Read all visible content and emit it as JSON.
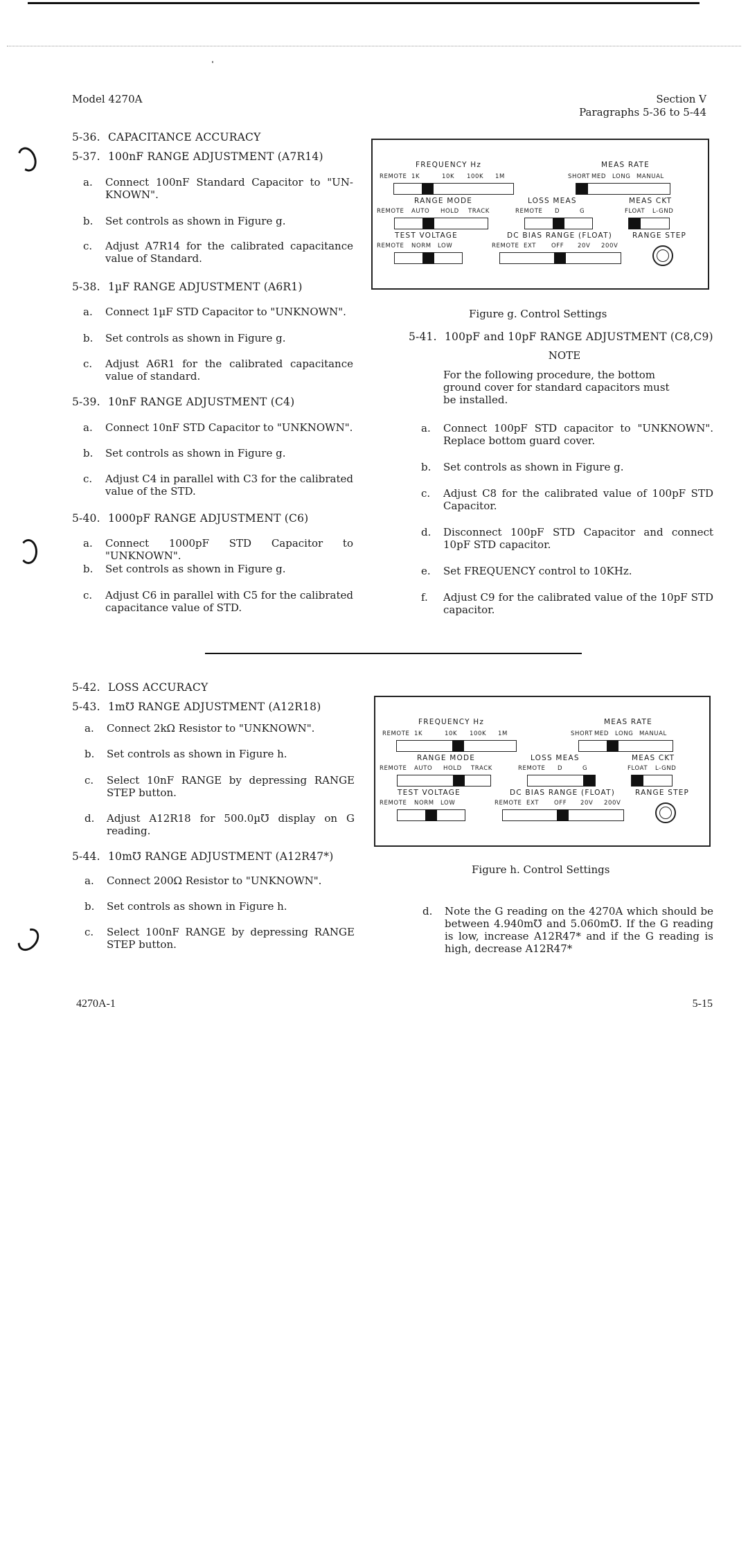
{
  "header": {
    "model": "Model 4270A",
    "section": "Section V",
    "paragraphs": "Paragraphs 5-36 to 5-44"
  },
  "left_column_top": [
    {
      "num": "5-36.",
      "title": "CAPACITANCE ACCURACY",
      "steps": []
    },
    {
      "num": "5-37.",
      "title": "100nF RANGE ADJUSTMENT (A7R14)",
      "steps": [
        {
          "label": "a.",
          "text": "Connect 100nF Standard Capacitor to \"UN-KNOWN\"."
        },
        {
          "label": "b.",
          "text": "Set controls as shown in Figure g."
        },
        {
          "label": "c.",
          "text": "Adjust A7R14 for the calibrated capacitance value of Standard."
        }
      ]
    },
    {
      "num": "5-38.",
      "title": "1µF RANGE ADJUSTMENT (A6R1)",
      "steps": [
        {
          "label": "a.",
          "text": "Connect 1µF STD Capacitor to \"UNKNOWN\"."
        },
        {
          "label": "b.",
          "text": "Set controls as shown in Figure g."
        },
        {
          "label": "c.",
          "text": "Adjust A6R1 for the calibrated capacitance value of standard."
        }
      ]
    },
    {
      "num": "5-39.",
      "title": "10nF RANGE ADJUSTMENT (C4)",
      "steps": [
        {
          "label": "a.",
          "text": "Connect 10nF STD Capacitor to \"UNKNOWN\"."
        },
        {
          "label": "b.",
          "text": "Set controls as shown in Figure g."
        },
        {
          "label": "c.",
          "text": "Adjust C4 in parallel with C3 for the calibrated value of the STD."
        }
      ]
    },
    {
      "num": "5-40.",
      "title": "1000pF RANGE ADJUSTMENT (C6)",
      "steps": [
        {
          "label": "a.",
          "text": "Connect 1000pF STD Capacitor to \"UNKNOWN\"."
        },
        {
          "label": "b.",
          "text": "Set controls as shown in Figure g."
        },
        {
          "label": "c.",
          "text": "Adjust C6 in parallel with C5 for the calibrated capacitance value of STD."
        }
      ]
    }
  ],
  "right_column_top": {
    "figure_caption": "Figure g.   Control Settings",
    "para": {
      "num": "5-41.",
      "title": "100pF and 10pF RANGE ADJUSTMENT (C8,C9)"
    },
    "note_title": "NOTE",
    "note_body": "For the following procedure, the bottom ground cover for standard capacitors must be installed.",
    "steps": [
      {
        "label": "a.",
        "text": "Connect 100pF STD capacitor to \"UNKNOWN\". Replace bottom guard cover."
      },
      {
        "label": "b.",
        "text": "Set controls as shown in Figure g."
      },
      {
        "label": "c.",
        "text": "Adjust C8 for the calibrated value of 100pF STD Capacitor."
      },
      {
        "label": "d.",
        "text": "Disconnect 100pF STD Capacitor and connect 10pF STD capacitor."
      },
      {
        "label": "e.",
        "text": "Set FREQUENCY control to 10KHz."
      },
      {
        "label": "f.",
        "text": "Adjust C9 for the calibrated value of the 10pF STD capacitor."
      }
    ]
  },
  "left_column_bottom": [
    {
      "num": "5-42.",
      "title": "LOSS ACCURACY",
      "steps": []
    },
    {
      "num": "5-43.",
      "title": "1m℧ RANGE ADJUSTMENT (A12R18)",
      "steps": [
        {
          "label": "a.",
          "text": "Connect 2kΩ Resistor to \"UNKNOWN\"."
        },
        {
          "label": "b.",
          "text": "Set controls as shown in Figure h."
        },
        {
          "label": "c.",
          "text": "Select 10nF RANGE by depressing RANGE STEP button."
        },
        {
          "label": "d.",
          "text": "Adjust A12R18 for 500.0µ℧ display on G reading."
        }
      ]
    },
    {
      "num": "5-44.",
      "title": "10m℧ RANGE ADJUSTMENT (A12R47*)",
      "steps": [
        {
          "label": "a.",
          "text": "Connect 200Ω Resistor to \"UNKNOWN\"."
        },
        {
          "label": "b.",
          "text": "Set controls as shown in Figure h."
        },
        {
          "label": "c.",
          "text": "Select 100nF RANGE by depressing RANGE STEP button."
        }
      ]
    }
  ],
  "right_column_bottom": {
    "figure_caption": "Figure h.   Control Settings",
    "steps": [
      {
        "label": "d.",
        "text": "Note the G reading on the 4270A which should be between 4.940m℧ and 5.060m℧. If the G reading is low, increase A12R47* and if the G reading is high, decrease A12R47*"
      }
    ]
  },
  "panel_labels": {
    "frequency": {
      "title": "FREQUENCY Hz",
      "options": [
        "REMOTE",
        "1K",
        "10K",
        "100K",
        "1M"
      ]
    },
    "meas_rate": {
      "title": "MEAS RATE",
      "options": [
        "SHORT",
        "MED",
        "LONG",
        "MANUAL"
      ]
    },
    "range_mode": {
      "title": "RANGE MODE",
      "options": [
        "REMOTE",
        "AUTO",
        "HOLD",
        "TRACK"
      ]
    },
    "loss_meas": {
      "title": "LOSS MEAS",
      "options": [
        "REMOTE",
        "D",
        "G"
      ]
    },
    "meas_ckt": {
      "title": "MEAS CKT",
      "options": [
        "FLOAT",
        "L-GND"
      ]
    },
    "test_voltage": {
      "title": "TEST VOLTAGE",
      "options": [
        "REMOTE",
        "NORM",
        "LOW"
      ]
    },
    "dc_bias": {
      "title": "DC BIAS RANGE (FLOAT)",
      "options": [
        "REMOTE",
        "EXT",
        "OFF",
        "20V",
        "200V"
      ]
    },
    "range_step": {
      "title": "RANGE STEP"
    }
  },
  "figure_g_settings": {
    "frequency": "1K",
    "meas_rate": "SHORT",
    "range_mode": "AUTO",
    "loss_meas": "D",
    "meas_ckt": "FLOAT",
    "test_voltage": "NORM",
    "dc_bias": "OFF"
  },
  "figure_h_settings": {
    "frequency": "10K",
    "meas_rate": "MED",
    "range_mode": "HOLD",
    "loss_meas": "G",
    "meas_ckt": "FLOAT",
    "test_voltage": "NORM",
    "dc_bias": "OFF"
  },
  "footer": {
    "left": "4270A-1",
    "right": "5-15"
  }
}
